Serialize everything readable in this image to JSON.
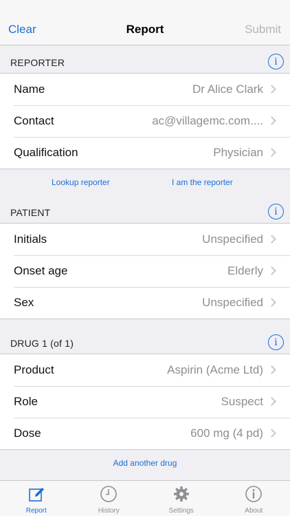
{
  "navbar": {
    "left": "Clear",
    "title": "Report",
    "right": "Submit"
  },
  "sections": {
    "reporter": {
      "header": "REPORTER",
      "rows": [
        {
          "key": "Name",
          "value": "Dr Alice Clark"
        },
        {
          "key": "Contact",
          "value": "ac@villagemc.com...."
        },
        {
          "key": "Qualification",
          "value": "Physician"
        }
      ],
      "links": [
        "Lookup reporter",
        "I am the reporter"
      ]
    },
    "patient": {
      "header": "PATIENT",
      "rows": [
        {
          "key": "Initials",
          "value": "Unspecified"
        },
        {
          "key": "Onset age",
          "value": "Elderly"
        },
        {
          "key": "Sex",
          "value": "Unspecified"
        }
      ]
    },
    "drug": {
      "header": "DRUG 1 (of 1)",
      "rows": [
        {
          "key": "Product",
          "value": "Aspirin (Acme Ltd)"
        },
        {
          "key": "Role",
          "value": "Suspect"
        },
        {
          "key": "Dose",
          "value": "600 mg  (4 pd)"
        }
      ],
      "link": "Add another drug"
    }
  },
  "info_glyph": "i",
  "tabs": [
    {
      "label": "Report",
      "icon": "pencil-icon",
      "active": true
    },
    {
      "label": "History",
      "icon": "clock-icon",
      "active": false
    },
    {
      "label": "Settings",
      "icon": "gear-icon",
      "active": false
    },
    {
      "label": "About",
      "icon": "info-icon",
      "active": false
    }
  ],
  "colors": {
    "accent": "#1a6fd4",
    "background": "#efeff4",
    "value_text": "#8e8e93"
  }
}
